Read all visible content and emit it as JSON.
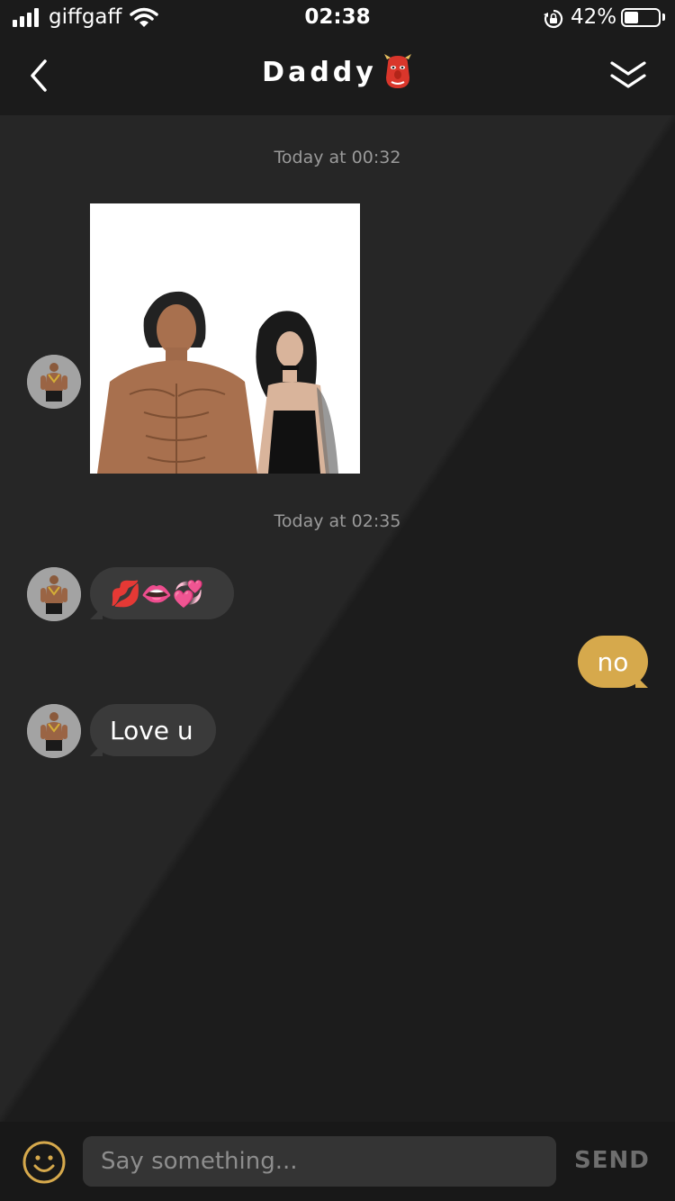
{
  "status_bar": {
    "carrier": "giffgaff",
    "time": "02:38",
    "battery_pct": "42%",
    "battery_level": 0.42,
    "icons": [
      "signal-icon",
      "wifi-icon",
      "rotation-lock-icon",
      "battery-icon"
    ]
  },
  "header": {
    "title": "Daddy",
    "title_emoji": "mask-icon",
    "back_icon": "chevron-left-icon",
    "collapse_icon": "double-chevron-down-icon"
  },
  "chat": {
    "groups": [
      {
        "timestamp": "Today at 00:32"
      },
      {
        "timestamp": "Today at 02:35"
      }
    ],
    "messages": [
      {
        "sender": "them",
        "type": "image"
      },
      {
        "sender": "them",
        "type": "emoji",
        "text": "💋👄💞"
      },
      {
        "sender": "me",
        "type": "text",
        "text": "no"
      },
      {
        "sender": "them",
        "type": "text",
        "text": "Love u"
      }
    ]
  },
  "composer": {
    "placeholder": "Say something...",
    "send_label": "SEND",
    "emoji_icon": "smiley-icon"
  },
  "colors": {
    "background": "#1e1e1e",
    "incoming_bubble": "#3a3a3a",
    "outgoing_bubble": "#d6a94c",
    "accent": "#d6a94c"
  }
}
